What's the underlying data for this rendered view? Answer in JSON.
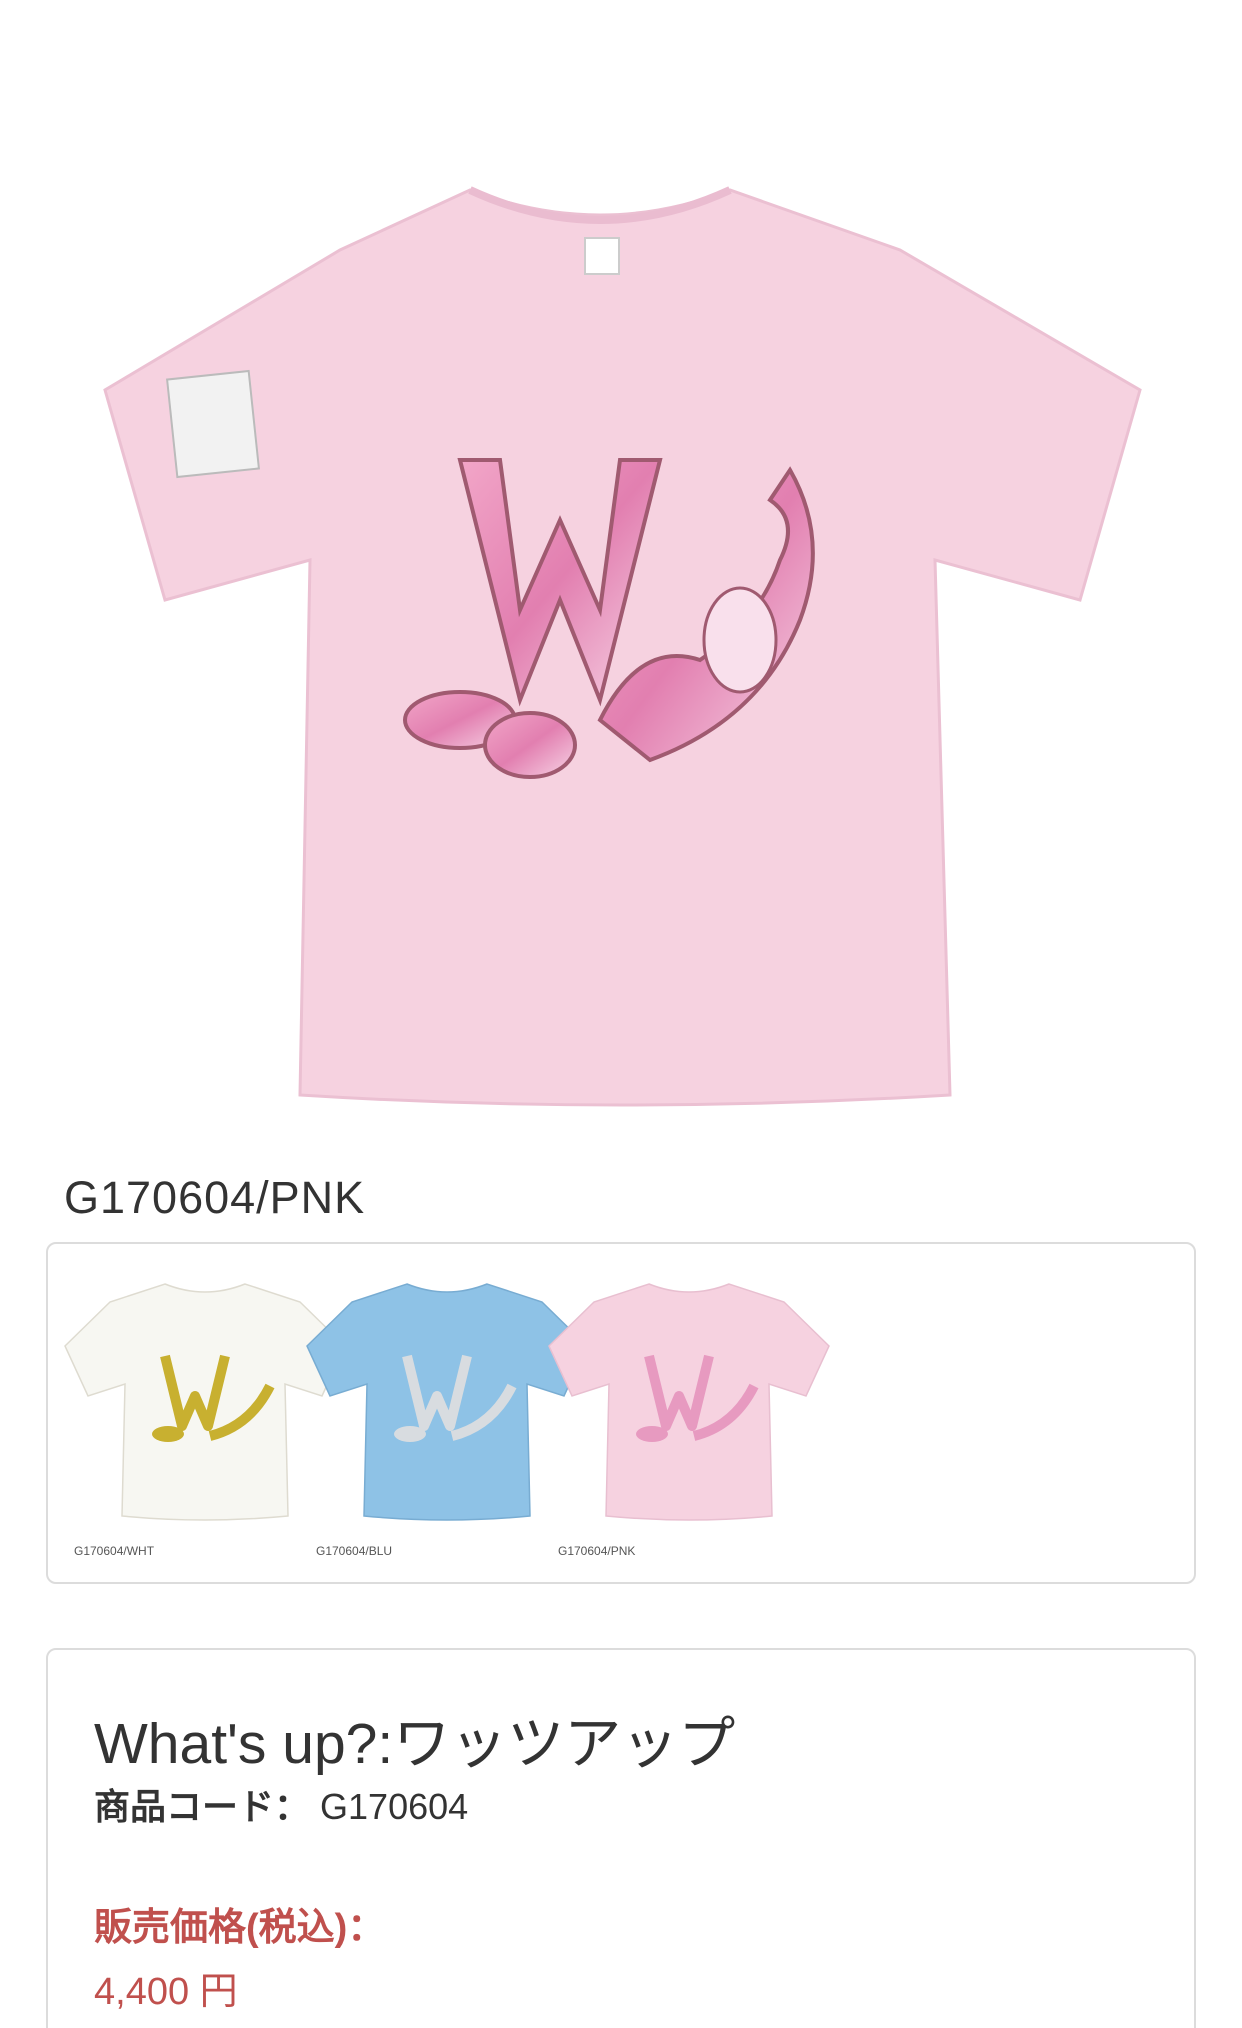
{
  "main_image": {
    "icon": "pink-tshirt-image",
    "color": "#f6d2e0"
  },
  "variant_code": "G170604/PNK",
  "thumbnails": [
    {
      "label": "G170604/WHT",
      "color": "#f7f7f2",
      "print": "#c8b030"
    },
    {
      "label": "G170604/BLU",
      "color": "#8ec2e6",
      "print": "#c8ccd0"
    },
    {
      "label": "G170604/PNK",
      "color": "#f6d2e0",
      "print": "#e79ac0"
    }
  ],
  "product": {
    "name": "What's up?:ワッツアップ",
    "code_label": "商品コード：",
    "code_value": "G170604",
    "price_label": "販売価格(税込)：",
    "price_value": "4,400 円"
  },
  "colors": {
    "price": "#c0504d",
    "border": "#dcdcdc"
  }
}
